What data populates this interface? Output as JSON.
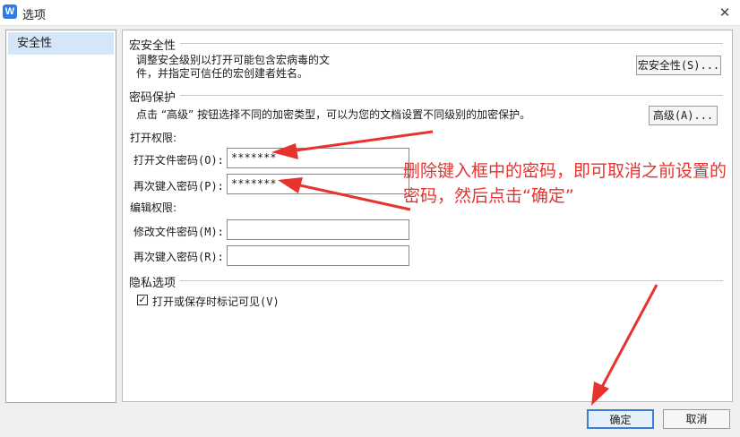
{
  "window": {
    "app_icon_glyph": "W",
    "title": "选项",
    "close_glyph": "✕"
  },
  "sidebar": {
    "items": [
      {
        "label": "安全性",
        "selected": true
      }
    ]
  },
  "macro": {
    "section_title": "宏安全性",
    "description_line1": "调整安全级别以打开可能包含宏病毒的文件，并指定可信任的宏创建者姓名。",
    "button_label": "宏安全性(S)..."
  },
  "password": {
    "section_title": "密码保护",
    "description": "点击 “高级” 按钮选择不同的加密类型，可以为您的文档设置不同级别的加密保护。",
    "advanced_button": "高级(A)...",
    "open_group_label": "打开权限:",
    "open_password_label": "打开文件密码(O):",
    "open_password_value": "*******",
    "reenter_open_label": "再次键入密码(P):",
    "reenter_open_value": "*******",
    "edit_group_label": "编辑权限:",
    "modify_password_label": "修改文件密码(M):",
    "modify_password_value": "",
    "reenter_modify_label": "再次键入密码(R):",
    "reenter_modify_value": ""
  },
  "privacy": {
    "section_title": "隐私选项",
    "checkbox_label": "打开或保存时标记可见(V)",
    "checked": true,
    "check_glyph": "✓"
  },
  "annotation": {
    "text": "删除键入框中的密码，即可取消之前设置的密码，然后点击“确定”",
    "color": "#e8322e"
  },
  "footer": {
    "ok_label": "确定",
    "cancel_label": "取消"
  },
  "colors": {
    "ok_border": "#3c7fd8",
    "selected_bg": "#d5e6f8"
  }
}
